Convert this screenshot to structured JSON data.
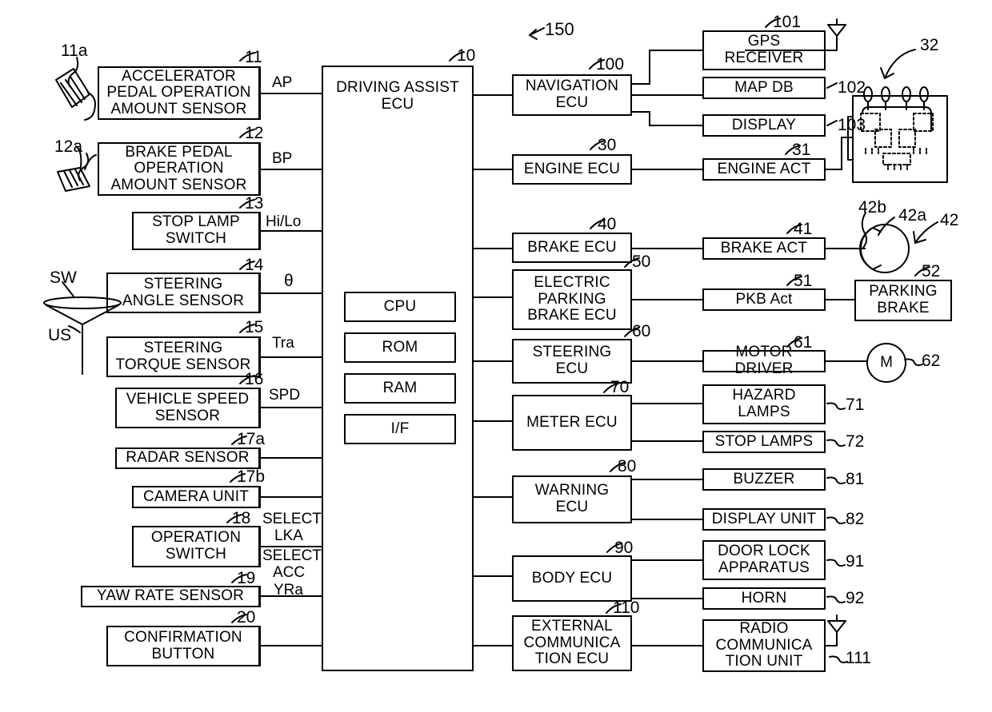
{
  "figure": {
    "reference_label": "150",
    "type": "vehicle driving assist system block diagram"
  },
  "left_sensors": [
    {
      "num": "11",
      "label": "ACCELERATOR\nPEDAL OPERATION\nAMOUNT SENSOR",
      "signal": "AP",
      "icon_num": "11a",
      "icon": "accelerator-pedal-icon"
    },
    {
      "num": "12",
      "label": "BRAKE PEDAL\nOPERATION\nAMOUNT SENSOR",
      "signal": "BP",
      "icon_num": "12a",
      "icon": "brake-pedal-icon"
    },
    {
      "num": "13",
      "label": "STOP LAMP\nSWITCH",
      "signal": "Hi/Lo"
    },
    {
      "num": "14",
      "label": "STEERING\nANGLE SENSOR",
      "signal": "θ"
    },
    {
      "num": "15",
      "label": "STEERING\nTORQUE SENSOR",
      "signal": "Tra"
    },
    {
      "num": "16",
      "label": "VEHICLE SPEED\nSENSOR",
      "signal": "SPD"
    },
    {
      "num": "17a",
      "label": "RADAR SENSOR",
      "signal": ""
    },
    {
      "num": "17b",
      "label": "CAMERA UNIT",
      "signal": ""
    },
    {
      "num": "18",
      "label": "OPERATION\nSWITCH",
      "signal": "SELECT\nLKA"
    },
    {
      "num": "19",
      "label": "YAW RATE SENSOR",
      "signal": "YRa"
    },
    {
      "num": "20",
      "label": "CONFIRMATION\nBUTTON",
      "signal": ""
    }
  ],
  "extra_signals": {
    "select_acc": "SELECT\nACC",
    "steering_wheel_tag": "SW",
    "steering_shaft_tag": "US"
  },
  "central_ecu": {
    "num": "10",
    "title": "DRIVING ASSIST\nECU",
    "modules": [
      {
        "label": "CPU"
      },
      {
        "label": "ROM"
      },
      {
        "label": "RAM"
      },
      {
        "label": "I/F"
      }
    ]
  },
  "mid_ecus": [
    {
      "num": "100",
      "label": "NAVIGATION\nECU"
    },
    {
      "num": "30",
      "label": "ENGINE ECU"
    },
    {
      "num": "40",
      "label": "BRAKE ECU"
    },
    {
      "num": "50",
      "label": "ELECTRIC\nPARKING\nBRAKE ECU"
    },
    {
      "num": "60",
      "label": "STEERING\nECU"
    },
    {
      "num": "70",
      "label": "METER ECU"
    },
    {
      "num": "80",
      "label": "WARNING\nECU"
    },
    {
      "num": "90",
      "label": "BODY ECU"
    },
    {
      "num": "110",
      "label": "EXTERNAL\nCOMMUNICA\nTION ECU"
    }
  ],
  "right_devices": [
    {
      "num": "101",
      "label": "GPS\nRECEIVER",
      "has_antenna": true
    },
    {
      "num": "102",
      "label": "MAP DB"
    },
    {
      "num": "103",
      "label": "DISPLAY"
    },
    {
      "num": "31",
      "label": "ENGINE ACT"
    },
    {
      "num": "41",
      "label": "BRAKE ACT"
    },
    {
      "num": "51",
      "label": "PKB  Act"
    },
    {
      "num": "61",
      "label": "MOTOR DRIVER"
    },
    {
      "num": "71",
      "label": "HAZARD\nLAMPS"
    },
    {
      "num": "72",
      "label": "STOP LAMPS"
    },
    {
      "num": "81",
      "label": "BUZZER"
    },
    {
      "num": "82",
      "label": "DISPLAY UNIT"
    },
    {
      "num": "91",
      "label": "DOOR LOCK\nAPPARATUS"
    },
    {
      "num": "92",
      "label": "HORN"
    },
    {
      "num": "111",
      "label": "RADIO\nCOMMUNICA\nTION UNIT",
      "has_antenna": true
    }
  ],
  "far_right": [
    {
      "num": "32",
      "label": "",
      "icon": "engine-illustration"
    },
    {
      "num": "42",
      "label": "",
      "icon": "brake-disc-icon",
      "sub": [
        {
          "num": "42a"
        },
        {
          "num": "42b"
        }
      ]
    },
    {
      "num": "52",
      "label": "PARKING\nBRAKE"
    },
    {
      "num": "62",
      "label": "M",
      "icon": "motor-circle-icon"
    }
  ],
  "colors": {
    "ink": "#000000",
    "paper": "#ffffff"
  }
}
